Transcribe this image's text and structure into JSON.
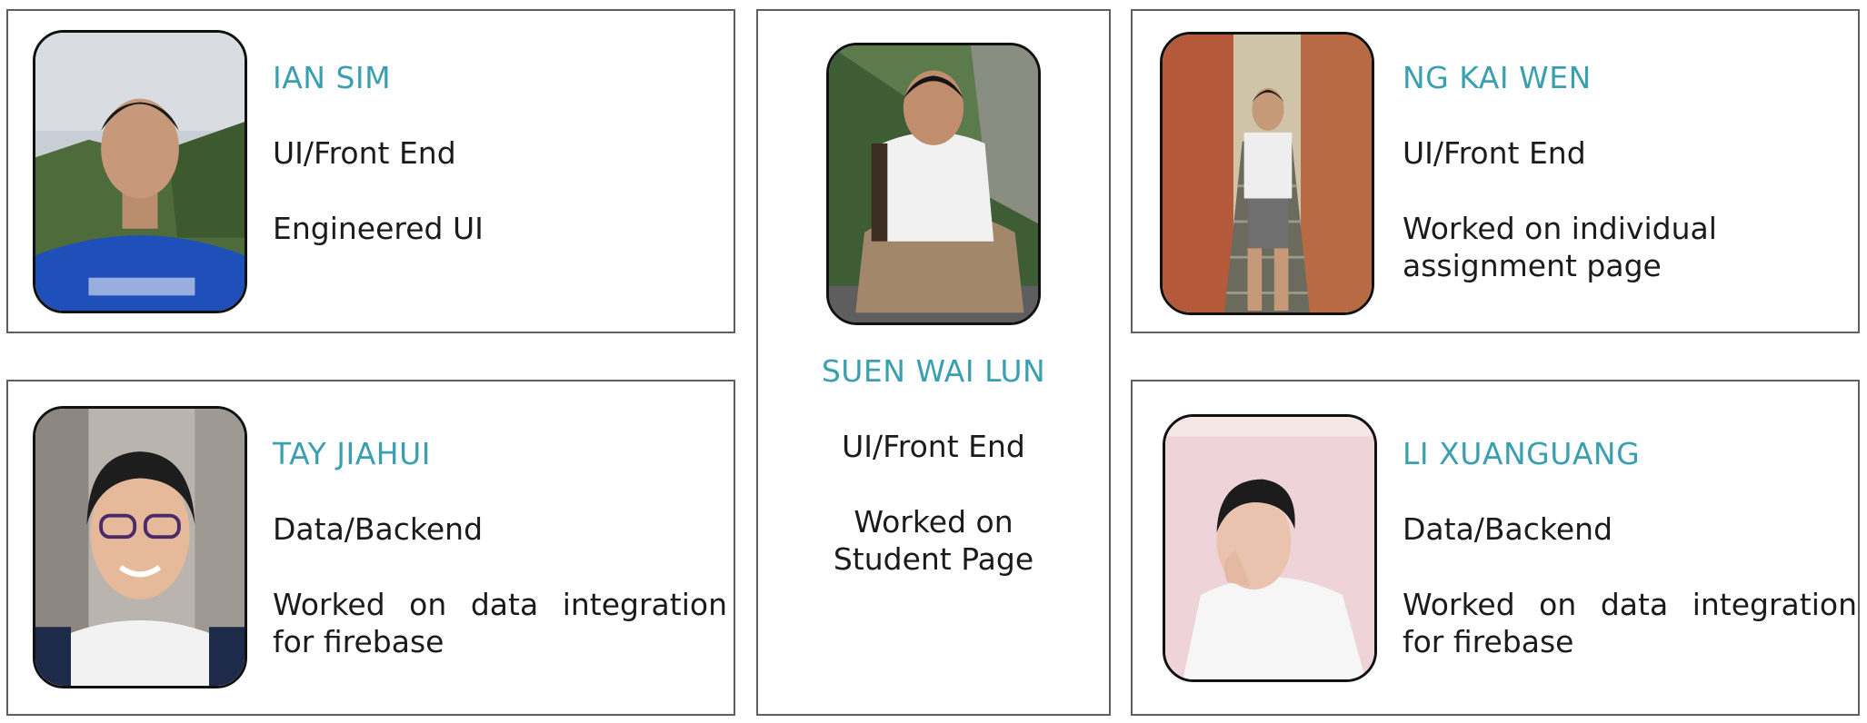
{
  "accent_color": "#3a9fb0",
  "members": {
    "ian": {
      "name": "IAN SIM",
      "role": "UI/Front End",
      "task": "Engineered UI",
      "photo_icon": "portrait-photo-icon"
    },
    "tay": {
      "name": "TAY JIAHUI",
      "role": "Data/Backend",
      "task": "Worked on data integration for firebase",
      "photo_icon": "portrait-photo-icon"
    },
    "suen": {
      "name": "SUEN WAI LUN",
      "role": "UI/Front End",
      "task_line1": "Worked on",
      "task_line2": "Student Page",
      "photo_icon": "portrait-photo-icon"
    },
    "ng": {
      "name": "NG KAI WEN",
      "role": "UI/Front End",
      "task_line1": "Worked on individual",
      "task_line2": "assignment page",
      "photo_icon": "portrait-photo-icon"
    },
    "li": {
      "name": "LI XUANGUANG",
      "role": "Data/Backend",
      "task": "Worked on data integration for firebase",
      "photo_icon": "portrait-photo-icon"
    }
  }
}
